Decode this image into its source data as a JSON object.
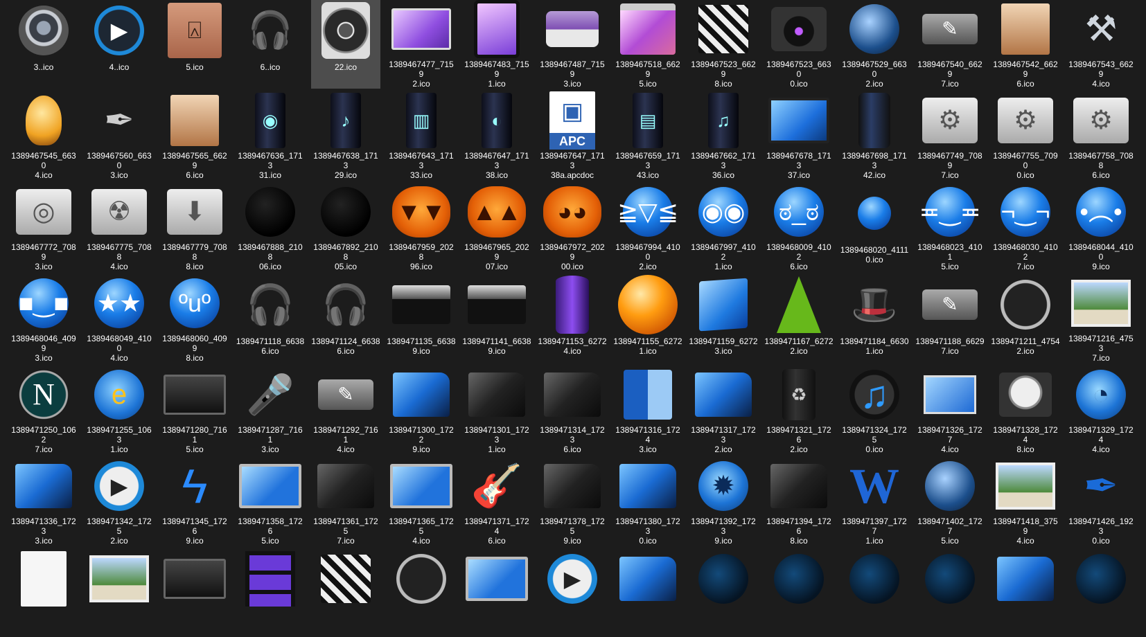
{
  "selected_index": 4,
  "items": [
    {
      "name": "3..ico",
      "icon": "speaker-icon",
      "style": "c-speaker i-circle"
    },
    {
      "name": "4..ico",
      "icon": "media-player-icon",
      "style": "c-media i-circle",
      "glyph": "▶"
    },
    {
      "name": "5.ico",
      "icon": "presentation-easel-icon",
      "style": "c-easel i-rect",
      "glyph": "⍓"
    },
    {
      "name": "6..ico",
      "icon": "headphones-icon",
      "style": "c-headph",
      "glyph": "🎧"
    },
    {
      "name": "22.ico",
      "icon": "woofer-speaker-icon",
      "style": "c-woofer"
    },
    {
      "name": "1389467477_71592.ico",
      "icon": "monitor-icon",
      "style": "c-monitor"
    },
    {
      "name": "1389467483_71591.ico",
      "icon": "tablet-icon",
      "style": "c-tablet"
    },
    {
      "name": "1389467487_71593.ico",
      "icon": "printer-icon",
      "style": "c-printer"
    },
    {
      "name": "1389467518_66295.ico",
      "icon": "browser-window-icon",
      "style": "c-window"
    },
    {
      "name": "1389467523_66298.ico",
      "icon": "clapperboard-icon",
      "style": "c-clapper"
    },
    {
      "name": "1389467523_66300.ico",
      "icon": "camera-icon",
      "style": "c-camera"
    },
    {
      "name": "1389467529_66302.ico",
      "icon": "globe-icon",
      "style": "c-globe i-circle"
    },
    {
      "name": "1389467540_66297.ico",
      "icon": "pen-tablet-icon",
      "style": "c-pentablet",
      "glyph": "✎"
    },
    {
      "name": "1389467542_66296.ico",
      "icon": "easel-portrait-icon",
      "style": "c-easel2"
    },
    {
      "name": "1389467543_66294.ico",
      "icon": "tools-icon",
      "style": "c-tools",
      "glyph": "⚒"
    },
    {
      "name": "1389467545_66304.ico",
      "icon": "light-bulb-icon",
      "style": "c-bulb"
    },
    {
      "name": "1389467560_66303.ico",
      "icon": "pen-nib-icon",
      "style": "c-pen",
      "glyph": "✒"
    },
    {
      "name": "1389467565_66296.ico",
      "icon": "easel-portrait-icon",
      "style": "c-easel2"
    },
    {
      "name": "1389467636_171331.ico",
      "icon": "video-tower-icon",
      "style": "c-tower",
      "glyph": "◉"
    },
    {
      "name": "1389467638_171329.ico",
      "icon": "music-tower-icon",
      "style": "c-tower",
      "glyph": "♪"
    },
    {
      "name": "1389467643_171333.ico",
      "icon": "archive-tower-icon",
      "style": "c-tower",
      "glyph": "▥"
    },
    {
      "name": "1389467647_171338.ico",
      "icon": "disc-tower-icon",
      "style": "c-tower",
      "glyph": "◐"
    },
    {
      "name": "1389467647_171338a.apcdoc",
      "icon": "apc-document-icon",
      "style": "c-apc"
    },
    {
      "name": "1389467659_171343.ico",
      "icon": "documents-tower-icon",
      "style": "c-tower",
      "glyph": "▤"
    },
    {
      "name": "1389467662_171336.ico",
      "icon": "music-disc-tower-icon",
      "style": "c-tower",
      "glyph": "♫"
    },
    {
      "name": "1389467678_171337.ico",
      "icon": "desktop-computer-icon",
      "style": "c-lcd"
    },
    {
      "name": "1389467698_171342.ico",
      "icon": "recycle-bin-tower-icon",
      "style": "c-cyl-dark"
    },
    {
      "name": "1389467749_70897.ico",
      "icon": "settings-folder-icon",
      "style": "c-folder-grey",
      "glyph": "⚙"
    },
    {
      "name": "1389467755_70900.ico",
      "icon": "tools-folder-icon",
      "style": "c-folder-grey",
      "glyph": "⚙"
    },
    {
      "name": "1389467758_70886.ico",
      "icon": "tools-folder-icon",
      "style": "c-folder-grey",
      "glyph": "⚙"
    },
    {
      "name": "1389467772_70893.ico",
      "icon": "disc-folder-icon",
      "style": "c-folder-grey",
      "glyph": "◎"
    },
    {
      "name": "1389467775_70884.ico",
      "icon": "radioactive-folder-icon",
      "style": "c-folder-grey",
      "glyph": "☢"
    },
    {
      "name": "1389467779_70888.ico",
      "icon": "download-folder-icon",
      "style": "c-folder-grey",
      "glyph": "⬇"
    },
    {
      "name": "1389467888_210806.ico",
      "icon": "black-wink-smiley-icon",
      "style": "c-smile-black i-circle"
    },
    {
      "name": "1389467892_210805.ico",
      "icon": "black-grin-smiley-icon",
      "style": "c-smile-black i-circle"
    },
    {
      "name": "1389467959_202896.ico",
      "icon": "pumpkin-icon",
      "style": "c-pumpkin",
      "glyph": "▼▼"
    },
    {
      "name": "1389467965_202907.ico",
      "icon": "pumpkin-icon",
      "style": "c-pumpkin",
      "glyph": "▲▲"
    },
    {
      "name": "1389467972_202900.ico",
      "icon": "pumpkin-scream-icon",
      "style": "c-pumpkin",
      "glyph": "◕◕"
    },
    {
      "name": "1389467994_41002.ico",
      "icon": "laughing-smiley-icon",
      "style": "c-smile-blue i-circle",
      "glyph": "≧▽≦"
    },
    {
      "name": "1389467997_41021.ico",
      "icon": "surprised-smiley-icon",
      "style": "c-smile-blue i-circle",
      "glyph": "◉◉"
    },
    {
      "name": "1389468009_41026.ico",
      "icon": "angry-smiley-icon",
      "style": "c-smile-blue i-circle",
      "glyph": "ಠ_ಠ"
    },
    {
      "name": "1389468020_41110.ico",
      "icon": "small-angry-smiley-icon",
      "style": "c-smile-blue i-circle c-small-blue",
      "glyph": ""
    },
    {
      "name": "1389468023_41015.ico",
      "icon": "grinning-smiley-icon",
      "style": "c-smile-blue i-circle",
      "glyph": "≖‿≖"
    },
    {
      "name": "1389468030_41027.ico",
      "icon": "sly-smiley-icon",
      "style": "c-smile-blue i-circle",
      "glyph": "¬‿¬"
    },
    {
      "name": "1389468044_41009.ico",
      "icon": "sad-smiley-icon",
      "style": "c-smile-blue i-circle",
      "glyph": "•︵•"
    },
    {
      "name": "1389468046_40993.ico",
      "icon": "cool-smiley-icon",
      "style": "c-smile-blue i-circle",
      "glyph": "■‿■"
    },
    {
      "name": "1389468049_41004.ico",
      "icon": "star-eyes-smiley-icon",
      "style": "c-smile-blue i-circle",
      "glyph": "★★"
    },
    {
      "name": "1389468060_40998.ico",
      "icon": "tongue-smiley-icon",
      "style": "c-smile-blue i-circle",
      "glyph": "ºuº"
    },
    {
      "name": "1389471118_66386.ico",
      "icon": "headphones-icon",
      "style": "c-mic",
      "glyph": "🎧"
    },
    {
      "name": "1389471124_66386.ico",
      "icon": "headphones-icon",
      "style": "c-mic",
      "glyph": "🎧"
    },
    {
      "name": "1389471135_66389.ico",
      "icon": "audio-mixer-icon",
      "style": "c-mixer"
    },
    {
      "name": "1389471141_66389.ico",
      "icon": "audio-mixer-icon",
      "style": "c-mixer"
    },
    {
      "name": "1389471153_62724.ico",
      "icon": "purple-cylinder-icon",
      "style": "c-cup"
    },
    {
      "name": "1389471155_62721.ico",
      "icon": "orange-sphere-icon",
      "style": "c-ball i-circle"
    },
    {
      "name": "1389471159_62723.ico",
      "icon": "blue-cube-icon",
      "style": "c-cube"
    },
    {
      "name": "1389471167_62722.ico",
      "icon": "green-cone-icon",
      "style": "c-cone"
    },
    {
      "name": "1389471184_66301.ico",
      "icon": "magic-hat-icon",
      "style": "c-hat",
      "glyph": "🎩"
    },
    {
      "name": "1389471188_66297.ico",
      "icon": "pen-tablet-icon",
      "style": "c-pentablet",
      "glyph": "✎"
    },
    {
      "name": "1389471211_47542.ico",
      "icon": "speedometer-gauge-icon",
      "style": "c-gauge i-circle"
    },
    {
      "name": "1389471216_47537.ico",
      "icon": "photos-icon",
      "style": "c-photos"
    },
    {
      "name": "1389471250_10627.ico",
      "icon": "netscape-icon",
      "style": "c-netscape i-circle",
      "glyph": "N"
    },
    {
      "name": "1389471255_10631.ico",
      "icon": "internet-explorer-icon",
      "style": "c-ie i-circle",
      "glyph": "e"
    },
    {
      "name": "1389471280_71615.ico",
      "icon": "tv-screen-icon",
      "style": "c-tv"
    },
    {
      "name": "1389471287_71613.ico",
      "icon": "microphone-icon",
      "style": "c-mic",
      "glyph": "🎤"
    },
    {
      "name": "1389471292_71614.ico",
      "icon": "pen-tablet-icon",
      "style": "c-pentablet",
      "glyph": "✎"
    },
    {
      "name": "1389471300_17229.ico",
      "icon": "blue-folder-icon",
      "style": "c-folder-blue"
    },
    {
      "name": "1389471301_17231.ico",
      "icon": "dark-folder-icon",
      "style": "c-folder-dark"
    },
    {
      "name": "1389471314_17236.ico",
      "icon": "dark-folder-icon",
      "style": "c-folder-dark"
    },
    {
      "name": "1389471316_17243.ico",
      "icon": "finder-icon",
      "style": "c-finder"
    },
    {
      "name": "1389471317_17232.ico",
      "icon": "headphones-folder-icon",
      "style": "c-folder-blue"
    },
    {
      "name": "1389471321_17262.ico",
      "icon": "recycle-bin-icon",
      "style": "c-bin",
      "glyph": "♻"
    },
    {
      "name": "1389471324_17250.ico",
      "icon": "music-note-icon",
      "style": "c-note i-circle",
      "glyph": "♫"
    },
    {
      "name": "1389471326_17274.ico",
      "icon": "desktop-pc-icon",
      "style": "c-pc"
    },
    {
      "name": "1389471328_17248.ico",
      "icon": "hard-drive-icon",
      "style": "c-hdd"
    },
    {
      "name": "1389471329_17244.ico",
      "icon": "firefox-icon",
      "style": "c-firefox i-circle",
      "glyph": "◔"
    },
    {
      "name": "1389471336_17233.ico",
      "icon": "globe-folder-icon",
      "style": "c-folder-blue"
    },
    {
      "name": "1389471342_17252.ico",
      "icon": "play-button-icon",
      "style": "c-play i-circle",
      "glyph": "▶"
    },
    {
      "name": "1389471345_17269.ico",
      "icon": "lightning-icon",
      "style": "c-bolt",
      "glyph": "ϟ"
    },
    {
      "name": "1389471358_17265.ico",
      "icon": "lcd-monitor-icon",
      "style": "c-screen"
    },
    {
      "name": "1389471361_17257.ico",
      "icon": "music-folder-icon",
      "style": "c-folder-dark"
    },
    {
      "name": "1389471365_17254.ico",
      "icon": "monitor-icon",
      "style": "c-screen"
    },
    {
      "name": "1389471371_17246.ico",
      "icon": "guitar-icon",
      "style": "c-guitar",
      "glyph": "🎸"
    },
    {
      "name": "1389471378_17259.ico",
      "icon": "pictures-folder-icon",
      "style": "c-folder-dark"
    },
    {
      "name": "1389471380_17230.ico",
      "icon": "documents-folder-icon",
      "style": "c-folder-blue"
    },
    {
      "name": "1389471392_17239.ico",
      "icon": "gear-saw-icon",
      "style": "c-firefox i-circle",
      "glyph": "✹"
    },
    {
      "name": "1389471394_17268.ico",
      "icon": "video-folder-icon",
      "style": "c-folder-dark"
    },
    {
      "name": "1389471397_17271.ico",
      "icon": "word-icon",
      "style": "c-w",
      "glyph": "W"
    },
    {
      "name": "1389471402_17275.ico",
      "icon": "globe-icon",
      "style": "c-globe i-circle"
    },
    {
      "name": "1389471418_37594.ico",
      "icon": "photo-camera-icon",
      "style": "c-photos"
    },
    {
      "name": "1389471426_19230.ico",
      "icon": "ink-pen-icon",
      "style": "c-ink",
      "glyph": "✒"
    },
    {
      "name": "",
      "icon": "document-icon",
      "style": "c-doc"
    },
    {
      "name": "",
      "icon": "photo-frame-icon",
      "style": "c-photos"
    },
    {
      "name": "",
      "icon": "dark-screen-icon",
      "style": "c-tv"
    },
    {
      "name": "",
      "icon": "film-strip-icon",
      "style": "c-filmstrip"
    },
    {
      "name": "",
      "icon": "clapperboard-icon",
      "style": "c-clapper"
    },
    {
      "name": "",
      "icon": "film-reel-icon",
      "style": "c-gauge i-circle"
    },
    {
      "name": "",
      "icon": "monitor-icon",
      "style": "c-screen"
    },
    {
      "name": "",
      "icon": "play-button-icon",
      "style": "c-play i-circle",
      "glyph": "▶"
    },
    {
      "name": "",
      "icon": "blue-folder-icon",
      "style": "c-folder-blue"
    },
    {
      "name": "",
      "icon": "dotted-globe-icon",
      "style": "c-dotglobe i-circle"
    },
    {
      "name": "",
      "icon": "dotted-globe-icon",
      "style": "c-dotglobe i-circle"
    },
    {
      "name": "",
      "icon": "dotted-globe-icon",
      "style": "c-dotglobe i-circle"
    },
    {
      "name": "",
      "icon": "dotted-globe-icon",
      "style": "c-dotglobe i-circle"
    },
    {
      "name": "",
      "icon": "blue-folder-icon",
      "style": "c-folder-blue"
    },
    {
      "name": "",
      "icon": "dotted-globe-icon",
      "style": "c-dotglobe i-circle"
    },
    {
      "name": "",
      "icon": "dotted-globe-icon",
      "style": "c-dotglobe i-circle"
    }
  ],
  "labels": [
    [
      "3..ico",
      ""
    ],
    [
      "4..ico",
      ""
    ],
    [
      "5.ico",
      ""
    ],
    [
      "6..ico",
      ""
    ],
    [
      "22.ico",
      ""
    ],
    [
      "1389467477_7159",
      "2.ico"
    ],
    [
      "1389467483_7159",
      "1.ico"
    ],
    [
      "1389467487_7159",
      "3.ico"
    ],
    [
      "1389467518_6629",
      "5.ico"
    ],
    [
      "1389467523_6629",
      "8.ico"
    ],
    [
      "1389467523_6630",
      "0.ico"
    ],
    [
      "1389467529_6630",
      "2.ico"
    ],
    [
      "1389467540_6629",
      "7.ico"
    ],
    [
      "1389467542_6629",
      "6.ico"
    ],
    [
      "1389467543_6629",
      "4.ico"
    ],
    [
      "1389467545_6630",
      "4.ico"
    ],
    [
      "1389467560_6630",
      "3.ico"
    ],
    [
      "1389467565_6629",
      "6.ico"
    ],
    [
      "1389467636_1713",
      "31.ico"
    ],
    [
      "1389467638_1713",
      "29.ico"
    ],
    [
      "1389467643_1713",
      "33.ico"
    ],
    [
      "1389467647_1713",
      "38.ico"
    ],
    [
      "1389467647_1713",
      "38a.apcdoc"
    ],
    [
      "1389467659_1713",
      "43.ico"
    ],
    [
      "1389467662_1713",
      "36.ico"
    ],
    [
      "1389467678_1713",
      "37.ico"
    ],
    [
      "1389467698_1713",
      "42.ico"
    ],
    [
      "1389467749_7089",
      "7.ico"
    ],
    [
      "1389467755_7090",
      "0.ico"
    ],
    [
      "1389467758_7088",
      "6.ico"
    ],
    [
      "1389467772_7089",
      "3.ico"
    ],
    [
      "1389467775_7088",
      "4.ico"
    ],
    [
      "1389467779_7088",
      "8.ico"
    ],
    [
      "1389467888_2108",
      "06.ico"
    ],
    [
      "1389467892_2108",
      "05.ico"
    ],
    [
      "1389467959_2028",
      "96.ico"
    ],
    [
      "1389467965_2029",
      "07.ico"
    ],
    [
      "1389467972_2029",
      "00.ico"
    ],
    [
      "1389467994_4100",
      "2.ico"
    ],
    [
      "1389467997_4102",
      "1.ico"
    ],
    [
      "1389468009_4102",
      "6.ico"
    ],
    [
      "1389468020_4111",
      "0.ico"
    ],
    [
      "1389468023_4101",
      "5.ico"
    ],
    [
      "1389468030_4102",
      "7.ico"
    ],
    [
      "1389468044_4100",
      "9.ico"
    ],
    [
      "1389468046_4099",
      "3.ico"
    ],
    [
      "1389468049_4100",
      "4.ico"
    ],
    [
      "1389468060_4099",
      "8.ico"
    ],
    [
      "1389471118_6638",
      "6.ico"
    ],
    [
      "1389471124_6638",
      "6.ico"
    ],
    [
      "1389471135_6638",
      "9.ico"
    ],
    [
      "1389471141_6638",
      "9.ico"
    ],
    [
      "1389471153_6272",
      "4.ico"
    ],
    [
      "1389471155_6272",
      "1.ico"
    ],
    [
      "1389471159_6272",
      "3.ico"
    ],
    [
      "1389471167_6272",
      "2.ico"
    ],
    [
      "1389471184_6630",
      "1.ico"
    ],
    [
      "1389471188_6629",
      "7.ico"
    ],
    [
      "1389471211_4754",
      "2.ico"
    ],
    [
      "1389471216_4753",
      "7.ico"
    ],
    [
      "1389471250_1062",
      "7.ico"
    ],
    [
      "1389471255_1063",
      "1.ico"
    ],
    [
      "1389471280_7161",
      "5.ico"
    ],
    [
      "1389471287_7161",
      "3.ico"
    ],
    [
      "1389471292_7161",
      "4.ico"
    ],
    [
      "1389471300_1722",
      "9.ico"
    ],
    [
      "1389471301_1723",
      "1.ico"
    ],
    [
      "1389471314_1723",
      "6.ico"
    ],
    [
      "1389471316_1724",
      "3.ico"
    ],
    [
      "1389471317_1723",
      "2.ico"
    ],
    [
      "1389471321_1726",
      "2.ico"
    ],
    [
      "1389471324_1725",
      "0.ico"
    ],
    [
      "1389471326_1727",
      "4.ico"
    ],
    [
      "1389471328_1724",
      "8.ico"
    ],
    [
      "1389471329_1724",
      "4.ico"
    ],
    [
      "1389471336_1723",
      "3.ico"
    ],
    [
      "1389471342_1725",
      "2.ico"
    ],
    [
      "1389471345_1726",
      "9.ico"
    ],
    [
      "1389471358_1726",
      "5.ico"
    ],
    [
      "1389471361_1725",
      "7.ico"
    ],
    [
      "1389471365_1725",
      "4.ico"
    ],
    [
      "1389471371_1724",
      "6.ico"
    ],
    [
      "1389471378_1725",
      "9.ico"
    ],
    [
      "1389471380_1723",
      "0.ico"
    ],
    [
      "1389471392_1723",
      "9.ico"
    ],
    [
      "1389471394_1726",
      "8.ico"
    ],
    [
      "1389471397_1727",
      "1.ico"
    ],
    [
      "1389471402_1727",
      "5.ico"
    ],
    [
      "1389471418_3759",
      "4.ico"
    ],
    [
      "1389471426_1923",
      "0.ico"
    ],
    [
      "",
      ""
    ],
    [
      "",
      ""
    ],
    [
      "",
      ""
    ],
    [
      "",
      ""
    ],
    [
      "",
      ""
    ],
    [
      "",
      ""
    ],
    [
      "",
      ""
    ],
    [
      "",
      ""
    ],
    [
      "",
      ""
    ],
    [
      "",
      ""
    ],
    [
      "",
      ""
    ],
    [
      "",
      ""
    ],
    [
      "",
      ""
    ],
    [
      "",
      ""
    ],
    [
      "",
      ""
    ]
  ]
}
